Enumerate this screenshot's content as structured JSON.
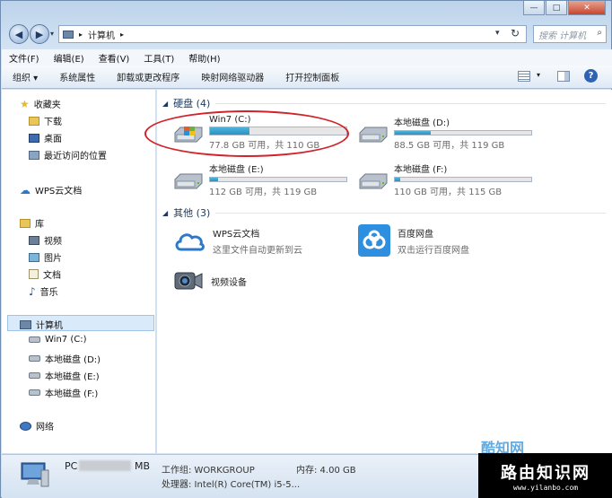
{
  "address": {
    "path": [
      "计算机"
    ]
  },
  "search": {
    "placeholder": "搜索 计算机"
  },
  "menu": [
    "文件(F)",
    "编辑(E)",
    "查看(V)",
    "工具(T)",
    "帮助(H)"
  ],
  "toolbar": [
    "组织 ▾",
    "系统属性",
    "卸载或更改程序",
    "映射网络驱动器",
    "打开控制面板"
  ],
  "nav": {
    "favorites": {
      "label": "收藏夹",
      "items": [
        "下载",
        "桌面",
        "最近访问的位置"
      ]
    },
    "wps": "WPS云文档",
    "libraries": {
      "label": "库",
      "items": [
        "视频",
        "图片",
        "文档",
        "音乐"
      ]
    },
    "computer": {
      "label": "计算机",
      "items": [
        "Win7 (C:)",
        "本地磁盘 (D:)",
        "本地磁盘 (E:)",
        "本地磁盘 (F:)"
      ]
    },
    "network": "网络"
  },
  "groups": {
    "hdd": "硬盘 (4)",
    "other": "其他 (3)"
  },
  "drives": [
    {
      "name": "Win7 (C:)",
      "free": "77.8 GB 可用，共 110 GB",
      "used_fraction": 0.29
    },
    {
      "name": "本地磁盘 (D:)",
      "free": "88.5 GB 可用，共 119 GB",
      "used_fraction": 0.26
    },
    {
      "name": "本地磁盘 (E:)",
      "free": "112 GB 可用，共 119 GB",
      "used_fraction": 0.06
    },
    {
      "name": "本地磁盘 (F:)",
      "free": "110 GB 可用，共 115 GB",
      "used_fraction": 0.04
    }
  ],
  "others": [
    {
      "name": "WPS云文档",
      "desc": "这里文件自动更新到云"
    },
    {
      "name": "百度网盘",
      "desc": "双击运行百度网盘"
    },
    {
      "name": "视频设备",
      "desc": ""
    }
  ],
  "details": {
    "name_prefix": "PC",
    "name_suffix": "MB",
    "workgroup": "工作组: WORKGROUP",
    "memory": "内存: 4.00 GB",
    "cpu": "处理器: Intel(R) Core(TM) i5-5..."
  },
  "watermark": {
    "brand": "酷知网",
    "site": "路由知识网",
    "url": "www.yilanbo.com"
  }
}
